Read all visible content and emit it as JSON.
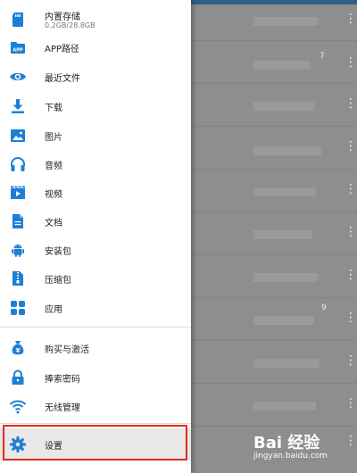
{
  "background": {
    "row_numbers": [
      "7",
      "9"
    ]
  },
  "drawer": {
    "storage": {
      "title": "内置存储",
      "subtitle": "0.2GB/28.8GB",
      "icon": "sd-card-icon"
    },
    "items": [
      {
        "label": "APP路径",
        "icon": "app-folder-icon"
      },
      {
        "label": "最近文件",
        "icon": "eye-icon"
      },
      {
        "label": "下载",
        "icon": "download-icon"
      },
      {
        "label": "图片",
        "icon": "image-icon"
      },
      {
        "label": "音频",
        "icon": "headphones-icon"
      },
      {
        "label": "视频",
        "icon": "video-icon"
      },
      {
        "label": "文档",
        "icon": "document-icon"
      },
      {
        "label": "安装包",
        "icon": "android-icon"
      },
      {
        "label": "压缩包",
        "icon": "zip-icon"
      },
      {
        "label": "应用",
        "icon": "apps-grid-icon"
      }
    ],
    "extras": [
      {
        "label": "购买与激活",
        "icon": "purchase-icon"
      },
      {
        "label": "捧索密码",
        "icon": "lock-icon"
      },
      {
        "label": "无线管理",
        "icon": "wifi-icon"
      }
    ],
    "settings": {
      "label": "设置",
      "icon": "gear-icon"
    }
  },
  "watermark": {
    "logo": "Bai 经验",
    "url": "jingyan.baidu.com"
  },
  "colors": {
    "icon_blue": "#1e7fd6",
    "highlight_red": "#e0281e"
  }
}
